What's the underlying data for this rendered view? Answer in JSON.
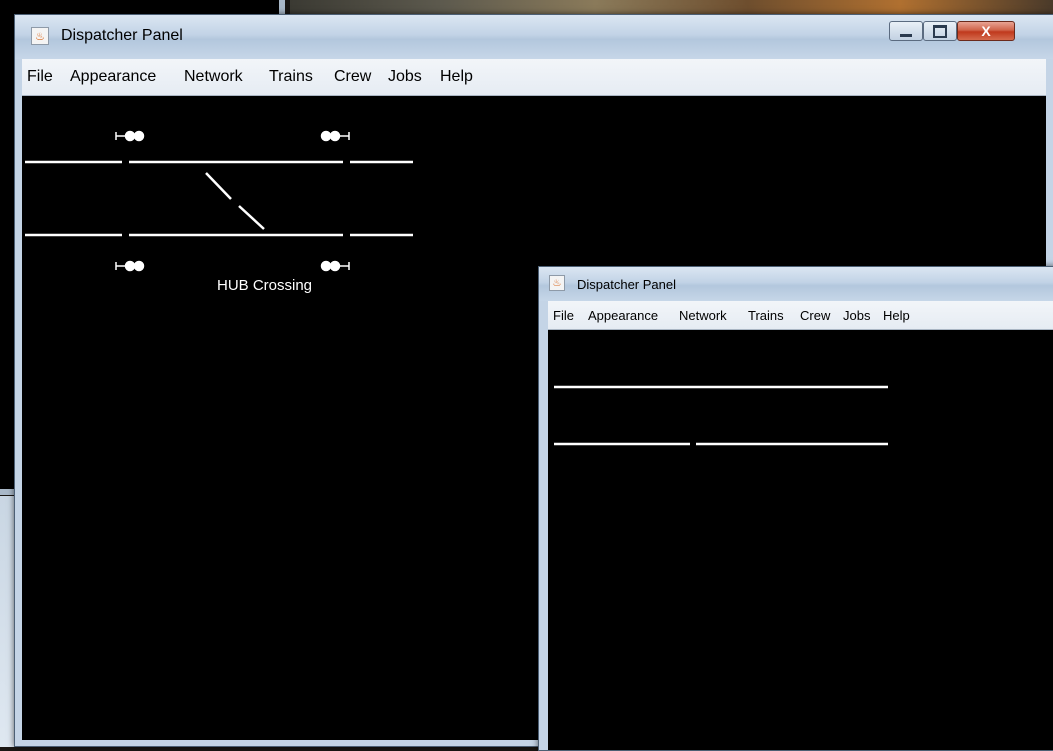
{
  "main_window": {
    "title": "Dispatcher Panel",
    "menu": [
      "File",
      "Appearance",
      "Network",
      "Trains",
      "Crew",
      "Jobs",
      "Help"
    ],
    "buttons": {
      "minimize": "–",
      "maximize": "□",
      "close": "X"
    },
    "track_label": "HUB Crossing"
  },
  "second_window": {
    "title": "Dispatcher Panel",
    "menu": [
      "File",
      "Appearance",
      "Network",
      "Trains",
      "Crew",
      "Jobs",
      "Help"
    ]
  }
}
